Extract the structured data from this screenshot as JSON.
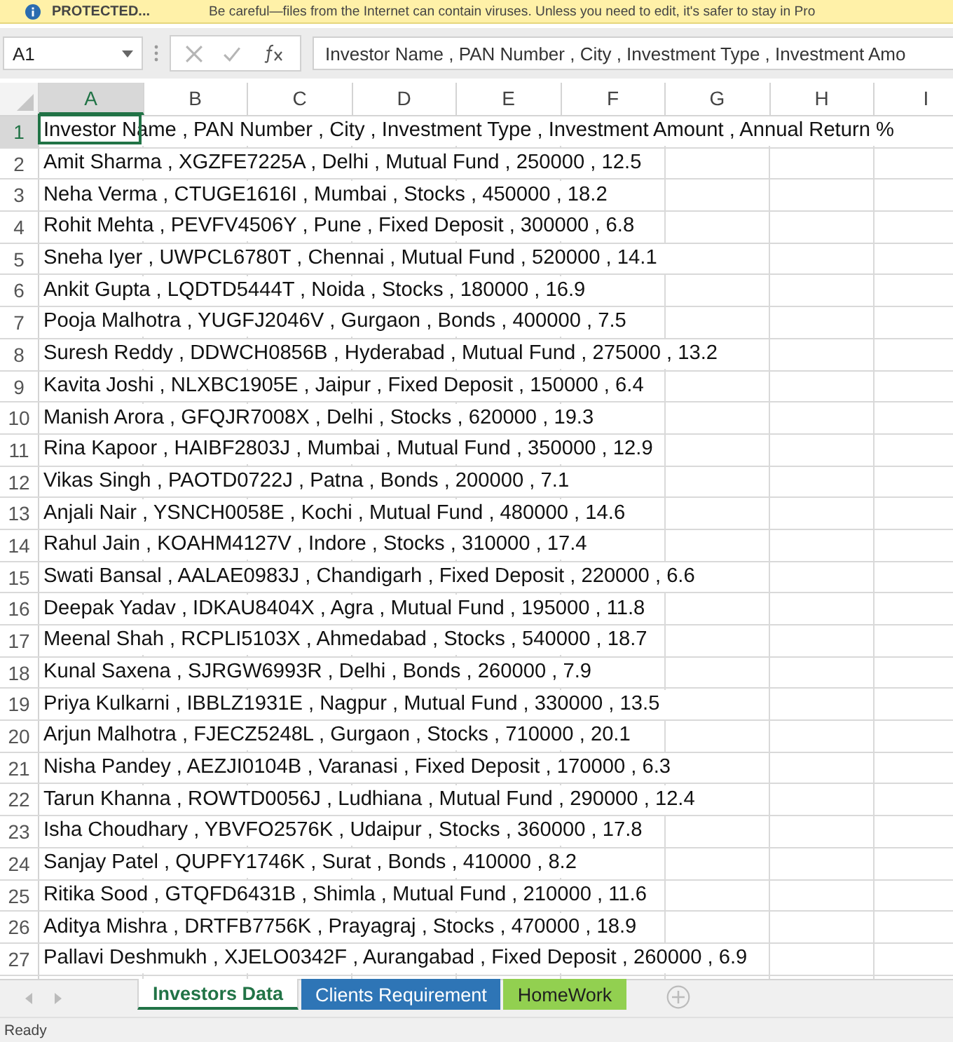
{
  "protected_bar": {
    "label": "PROTECTED...",
    "message": "Be careful—files from the Internet can contain viruses. Unless you need to edit, it's safer to stay in Pro"
  },
  "formula_bar": {
    "name_box": "A1",
    "cancel_disabled": true,
    "formula": "Investor Name , PAN Number , City , Investment Type , Investment Amo"
  },
  "columns": [
    {
      "label": "A",
      "selected": true
    },
    {
      "label": "B",
      "selected": false
    },
    {
      "label": "C",
      "selected": false
    },
    {
      "label": "D",
      "selected": false
    },
    {
      "label": "E",
      "selected": false
    },
    {
      "label": "F",
      "selected": false
    },
    {
      "label": "G",
      "selected": false
    },
    {
      "label": "H",
      "selected": false
    },
    {
      "label": "I",
      "selected": false
    }
  ],
  "rows": [
    {
      "number": "1",
      "selected": true,
      "text": "Investor Name , PAN Number , City , Investment Type , Investment Amount , Annual Return %"
    },
    {
      "number": "2",
      "selected": false,
      "text": "Amit Sharma , XGZFE7225A , Delhi , Mutual Fund , 250000 , 12.5"
    },
    {
      "number": "3",
      "selected": false,
      "text": "Neha Verma , CTUGE1616I , Mumbai , Stocks , 450000 , 18.2"
    },
    {
      "number": "4",
      "selected": false,
      "text": "Rohit Mehta , PEVFV4506Y , Pune , Fixed Deposit , 300000 , 6.8"
    },
    {
      "number": "5",
      "selected": false,
      "text": "Sneha Iyer , UWPCL6780T , Chennai , Mutual Fund , 520000 , 14.1"
    },
    {
      "number": "6",
      "selected": false,
      "text": "Ankit Gupta , LQDTD5444T , Noida , Stocks , 180000 , 16.9"
    },
    {
      "number": "7",
      "selected": false,
      "text": "Pooja Malhotra , YUGFJ2046V , Gurgaon , Bonds , 400000 , 7.5"
    },
    {
      "number": "8",
      "selected": false,
      "text": "Suresh Reddy , DDWCH0856B , Hyderabad , Mutual Fund , 275000 , 13.2"
    },
    {
      "number": "9",
      "selected": false,
      "text": "Kavita Joshi , NLXBC1905E , Jaipur , Fixed Deposit , 150000 , 6.4"
    },
    {
      "number": "10",
      "selected": false,
      "text": "Manish Arora , GFQJR7008X , Delhi , Stocks , 620000 , 19.3"
    },
    {
      "number": "11",
      "selected": false,
      "text": "Rina Kapoor , HAIBF2803J , Mumbai , Mutual Fund , 350000 , 12.9"
    },
    {
      "number": "12",
      "selected": false,
      "text": "Vikas Singh , PAOTD0722J , Patna , Bonds , 200000 , 7.1"
    },
    {
      "number": "13",
      "selected": false,
      "text": "Anjali Nair , YSNCH0058E , Kochi , Mutual Fund , 480000 , 14.6"
    },
    {
      "number": "14",
      "selected": false,
      "text": "Rahul Jain , KOAHM4127V , Indore , Stocks , 310000 , 17.4"
    },
    {
      "number": "15",
      "selected": false,
      "text": "Swati Bansal , AALAE0983J , Chandigarh , Fixed Deposit , 220000 , 6.6"
    },
    {
      "number": "16",
      "selected": false,
      "text": "Deepak Yadav , IDKAU8404X , Agra , Mutual Fund , 195000 , 11.8"
    },
    {
      "number": "17",
      "selected": false,
      "text": "Meenal Shah , RCPLI5103X , Ahmedabad , Stocks , 540000 , 18.7"
    },
    {
      "number": "18",
      "selected": false,
      "text": "Kunal Saxena , SJRGW6993R , Delhi , Bonds , 260000 , 7.9"
    },
    {
      "number": "19",
      "selected": false,
      "text": "Priya Kulkarni , IBBLZ1931E , Nagpur , Mutual Fund , 330000 , 13.5"
    },
    {
      "number": "20",
      "selected": false,
      "text": "Arjun Malhotra , FJECZ5248L , Gurgaon , Stocks , 710000 , 20.1"
    },
    {
      "number": "21",
      "selected": false,
      "text": "Nisha Pandey , AEZJI0104B , Varanasi , Fixed Deposit , 170000 , 6.3"
    },
    {
      "number": "22",
      "selected": false,
      "text": "Tarun Khanna , ROWTD0056J , Ludhiana , Mutual Fund , 290000 , 12.4"
    },
    {
      "number": "23",
      "selected": false,
      "text": "Isha Choudhary , YBVFO2576K , Udaipur , Stocks , 360000 , 17.8"
    },
    {
      "number": "24",
      "selected": false,
      "text": "Sanjay Patel , QUPFY1746K , Surat , Bonds , 410000 , 8.2"
    },
    {
      "number": "25",
      "selected": false,
      "text": "Ritika Sood , GTQFD6431B , Shimla , Mutual Fund , 210000 , 11.6"
    },
    {
      "number": "26",
      "selected": false,
      "text": "Aditya Mishra , DRTFB7756K , Prayagraj , Stocks , 470000 , 18.9"
    },
    {
      "number": "27",
      "selected": false,
      "text": "Pallavi Deshmukh , XJELO0342F , Aurangabad , Fixed Deposit , 260000 , 6.9"
    }
  ],
  "sheet_tabs": [
    {
      "label": "Investors Data",
      "selected": true,
      "color": "#ffffff"
    },
    {
      "label": "Clients Requirement",
      "selected": false,
      "color": "#2e75b6"
    },
    {
      "label": "HomeWork",
      "selected": false,
      "color": "#92d050"
    }
  ],
  "status_bar": {
    "text": "Ready"
  }
}
